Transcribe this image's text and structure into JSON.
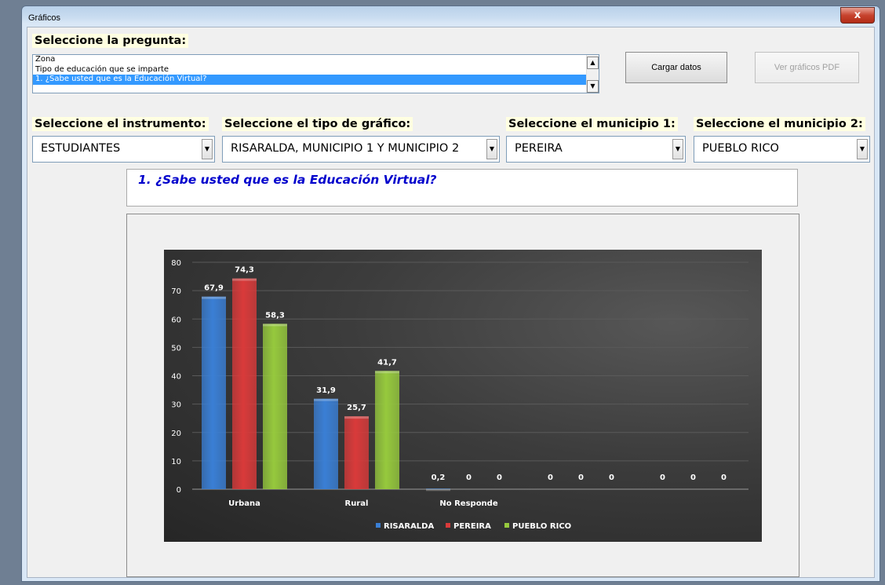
{
  "window": {
    "title": "Gráficos",
    "close_glyph": "x"
  },
  "question_section": {
    "header": "Seleccione la pregunta:",
    "items": [
      "Zona",
      "Tipo de educación que se imparte",
      "1. ¿Sabe usted que es la Educación Virtual?"
    ],
    "selected_index": 2
  },
  "buttons": {
    "load": "Cargar datos",
    "view_pdf": "Ver gráficos PDF"
  },
  "selectors": [
    {
      "label": "Seleccione el instrumento:",
      "value": "ESTUDIANTES"
    },
    {
      "label": "Seleccione el tipo de gráfico:",
      "value": "RISARALDA, MUNICIPIO 1 Y MUNICIPIO 2"
    },
    {
      "label": "Seleccione el municipio 1:",
      "value": "PEREIRA"
    },
    {
      "label": "Seleccione el municipio 2:",
      "value": "PUEBLO RICO"
    }
  ],
  "question_title": "1. ¿Sabe usted que es la Educación Virtual?",
  "colors": {
    "header_bg": "#ffffe1",
    "question_text": "#0000cc",
    "series": [
      "#3a7fd5",
      "#d93a3a",
      "#96c93d"
    ],
    "chart_bg": "#333333"
  },
  "chart_data": {
    "type": "bar",
    "title": "",
    "xlabel": "",
    "ylabel": "",
    "categories": [
      "Urbana",
      "Rural",
      "No Responde",
      "",
      ""
    ],
    "series": [
      {
        "name": "RISARALDA",
        "values": [
          67.9,
          31.9,
          0.2,
          0,
          0
        ]
      },
      {
        "name": "PEREIRA",
        "values": [
          74.3,
          25.7,
          0,
          0,
          0
        ]
      },
      {
        "name": "PUEBLO RICO",
        "values": [
          58.3,
          41.7,
          0,
          0,
          0
        ]
      }
    ],
    "value_labels": [
      [
        "67,9",
        "31,9",
        "0,2",
        "0",
        "0"
      ],
      [
        "74,3",
        "25,7",
        "0",
        "0",
        "0"
      ],
      [
        "58,3",
        "41,7",
        "0",
        "0",
        "0"
      ]
    ],
    "ylim": [
      0,
      80
    ],
    "yticks": [
      0,
      10,
      20,
      30,
      40,
      50,
      60,
      70,
      80
    ],
    "grid": true,
    "legend": "bottom-center"
  }
}
